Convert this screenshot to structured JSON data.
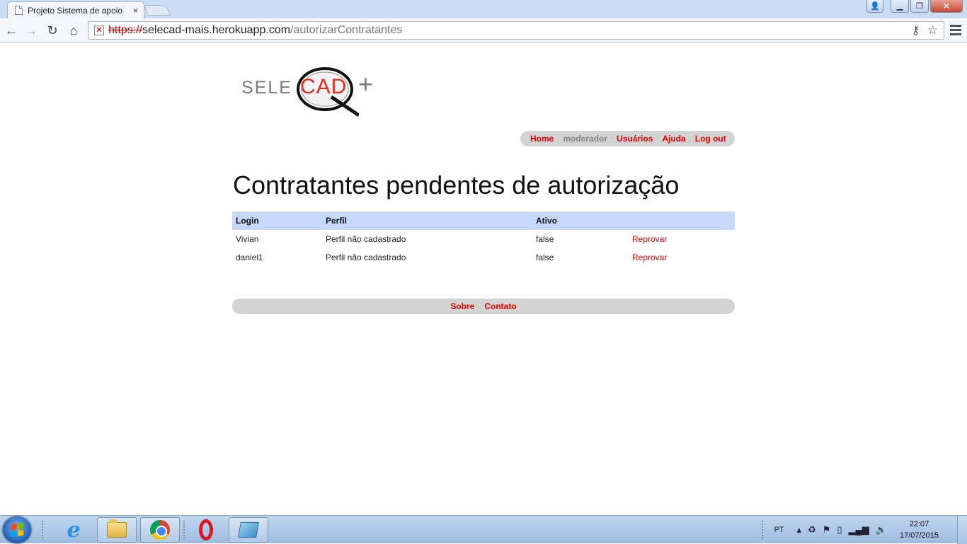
{
  "browser": {
    "tab_title": "Projeto Sistema de apoio",
    "tab_close": "×",
    "url_scheme": "https://",
    "url_host": "selecad-mais.herokuapp.com",
    "url_path": "/autorizarContratantes"
  },
  "logo": {
    "text_gray": "SELE",
    "text_red": "CAD",
    "text_plus": "+"
  },
  "top_menu": {
    "home": "Home",
    "user": "moderador",
    "users": "Usuários",
    "help": "Ajuda",
    "logout": "Log out"
  },
  "page": {
    "title": "Contratantes pendentes de autorização"
  },
  "table": {
    "headers": [
      "Login",
      "Perfil",
      "Ativo",
      ""
    ],
    "rows": [
      {
        "login": "Vivian",
        "perfil": "Perfil não cadastrado",
        "ativo": "false",
        "action": "Reprovar"
      },
      {
        "login": "daniel1",
        "perfil": "Perfil não cadastrado",
        "ativo": "false",
        "action": "Reprovar"
      }
    ]
  },
  "footer_menu": {
    "about": "Sobre",
    "contact": "Contato"
  },
  "taskbar": {
    "language": "PT",
    "time": "22:07",
    "date": "17/07/2015"
  },
  "colors": {
    "link_red": "#e20000",
    "menu_gray": "#d3d3d3",
    "table_header": "#c6d9fd",
    "logo_red": "#e32b1e"
  }
}
